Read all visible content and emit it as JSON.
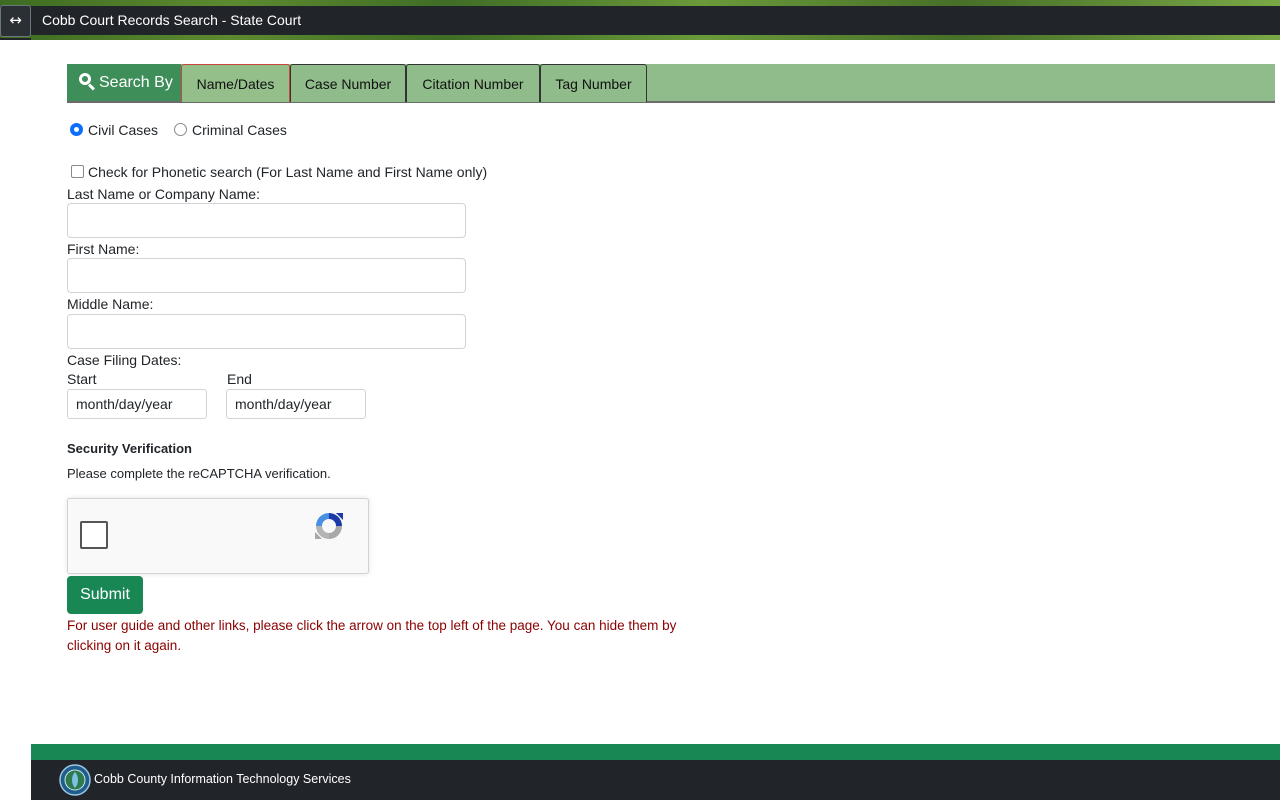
{
  "header": {
    "toggle_icon": "↔",
    "title": "Cobb Court Records Search - State Court"
  },
  "tabs": {
    "search_by": "Search By",
    "items": [
      {
        "label": "Name/Dates",
        "active": true
      },
      {
        "label": "Case Number",
        "active": false
      },
      {
        "label": "Citation Number",
        "active": false
      },
      {
        "label": "Tag Number",
        "active": false
      }
    ]
  },
  "form": {
    "case_types": [
      {
        "label": "Civil Cases",
        "checked": true
      },
      {
        "label": "Criminal Cases",
        "checked": false
      }
    ],
    "phonetic_label": "Check for Phonetic search (For Last Name and First Name only)",
    "last_name_label": "Last Name or Company Name:",
    "first_name_label": "First Name:",
    "middle_name_label": "Middle Name:",
    "filing_dates_label": "Case Filing Dates:",
    "start_label": "Start",
    "end_label": "End",
    "start_placeholder": "month/day/year",
    "end_placeholder": "month/day/year",
    "security_title": "Security Verification",
    "security_text": "Please complete the reCAPTCHA verification.",
    "submit_label": "Submit",
    "note": "For user guide and other links, please click the arrow on the top left of the page. You can hide them by clicking on it again."
  },
  "footer": {
    "text": "Cobb County Information Technology Services"
  },
  "colors": {
    "tab_green": "#8fbc8a",
    "search_by_green": "#3e8e59",
    "submit_green": "#198754",
    "note_red": "#8b0000",
    "dark_bar": "#212529"
  }
}
